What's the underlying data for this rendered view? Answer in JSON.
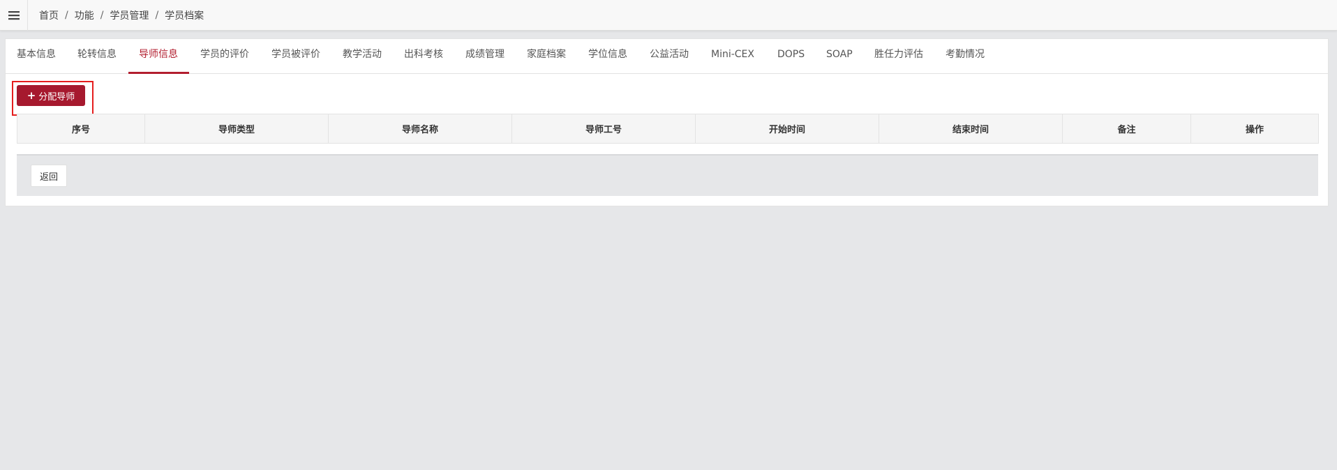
{
  "header": {
    "menu_icon": "hamburger-menu-icon",
    "breadcrumb": [
      "首页",
      "功能",
      "学员管理",
      "学员档案"
    ],
    "separator": "/"
  },
  "tabs": [
    {
      "label": "基本信息",
      "active": false
    },
    {
      "label": "轮转信息",
      "active": false
    },
    {
      "label": "导师信息",
      "active": true
    },
    {
      "label": "学员的评价",
      "active": false
    },
    {
      "label": "学员被评价",
      "active": false
    },
    {
      "label": "教学活动",
      "active": false
    },
    {
      "label": "出科考核",
      "active": false
    },
    {
      "label": "成绩管理",
      "active": false
    },
    {
      "label": "家庭档案",
      "active": false
    },
    {
      "label": "学位信息",
      "active": false
    },
    {
      "label": "公益活动",
      "active": false
    },
    {
      "label": "Mini-CEX",
      "active": false
    },
    {
      "label": "DOPS",
      "active": false
    },
    {
      "label": "SOAP",
      "active": false
    },
    {
      "label": "胜任力评估",
      "active": false
    },
    {
      "label": "考勤情况",
      "active": false
    }
  ],
  "toolbar": {
    "add_label": "分配导师",
    "add_icon": "plus-icon"
  },
  "table": {
    "columns": [
      "序号",
      "导师类型",
      "导师名称",
      "导师工号",
      "开始时间",
      "结束时间",
      "备注",
      "操作"
    ],
    "rows": []
  },
  "footer": {
    "back_label": "返回"
  },
  "colors": {
    "accent": "#b21e2f",
    "button": "#a6192e",
    "highlight": "#e51d1d",
    "page_bg": "#e6e7e9"
  }
}
